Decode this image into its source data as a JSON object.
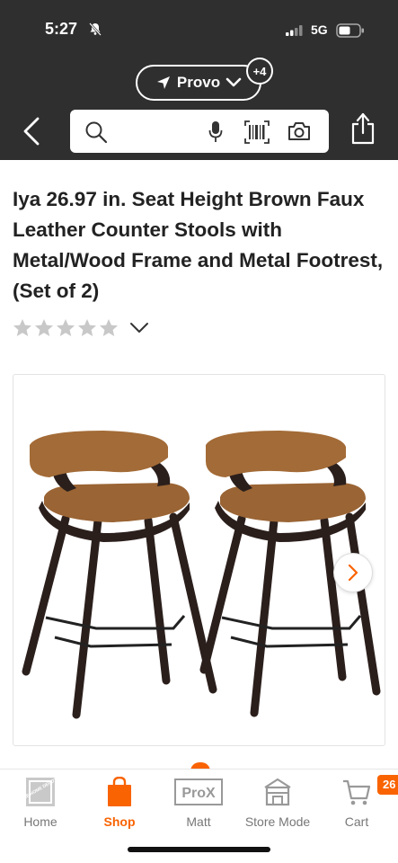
{
  "status_bar": {
    "time": "5:27",
    "network": "5G"
  },
  "header": {
    "location": "Provo",
    "location_badge": "+4"
  },
  "product": {
    "title": "Iya 26.97 in. Seat Height Brown Faux Leather Counter Stools with Metal/Wood Frame and Metal Footrest, (Set of 2)",
    "rating_stars": 0,
    "rating_max": 5
  },
  "bottom_nav": {
    "home": "Home",
    "shop": "Shop",
    "prox": "Matt",
    "prox_logo": "ProX",
    "home_logo": "THE HOME DEPOT",
    "store_mode": "Store Mode",
    "cart": "Cart",
    "cart_count": "26"
  },
  "colors": {
    "header_bg": "#2f2f2f",
    "accent": "#f96302",
    "star_empty": "#c8c8c8"
  }
}
